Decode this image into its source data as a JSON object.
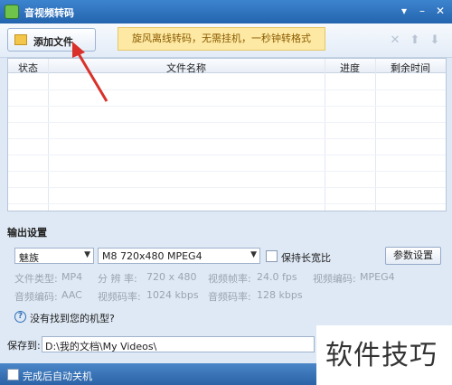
{
  "window": {
    "title": "音视频转码"
  },
  "toolbar": {
    "add_file_label": "添加文件",
    "banner_text": "旋风离线转码，无需挂机，一秒钟转格式"
  },
  "table": {
    "headers": {
      "status": "状态",
      "filename": "文件名称",
      "progress": "进度",
      "remaining": "剩余时间"
    }
  },
  "output": {
    "section_title": "输出设置",
    "device_value": "魅族",
    "format_value": "M8 720x480 MPEG4",
    "keep_ratio_label": "保持长宽比",
    "keep_ratio_checked": false,
    "params_button": "参数设置",
    "info": {
      "file_type_label": "文件类型:",
      "file_type_value": "MP4",
      "resolution_label": "分 辨 率:",
      "resolution_value": "720 x 480",
      "frame_rate_label": "视频帧率:",
      "frame_rate_value": "24.0 fps",
      "video_codec_label": "视频编码:",
      "video_codec_value": "MPEG4",
      "audio_codec_label": "音频编码:",
      "audio_codec_value": "AAC",
      "video_bitrate_label": "视频码率:",
      "video_bitrate_value": "1024 kbps",
      "audio_bitrate_label": "音频码率:",
      "audio_bitrate_value": "128 kbps"
    },
    "help_text": "没有找到您的机型?"
  },
  "save": {
    "label": "保存到:",
    "path": "D:\\我的文档\\My Videos\\"
  },
  "status": {
    "shutdown_label": "完成后自动关机",
    "shutdown_checked": false
  },
  "watermark": {
    "text": "软件技巧"
  },
  "colors": {
    "title_bar": "#2d6fbd",
    "banner_bg": "#fde9a3",
    "arrow": "#d9312a"
  }
}
